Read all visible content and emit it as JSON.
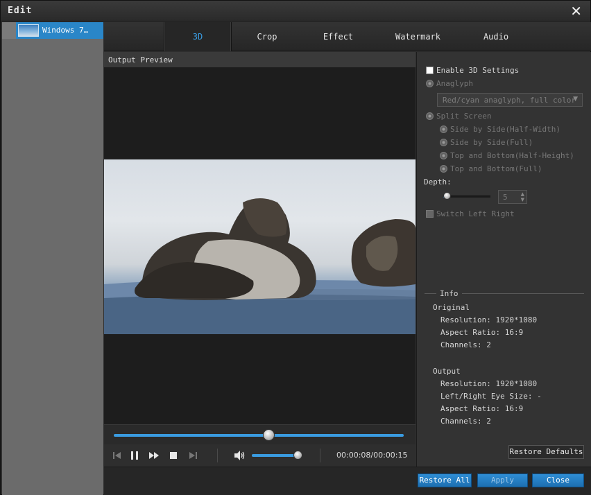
{
  "window": {
    "title": "Edit"
  },
  "file_list": {
    "items": [
      {
        "name": "Windows 7…",
        "selected": true
      }
    ]
  },
  "tabs": [
    {
      "label": "3D",
      "active": true
    },
    {
      "label": "Crop",
      "active": false
    },
    {
      "label": "Effect",
      "active": false
    },
    {
      "label": "Watermark",
      "active": false
    },
    {
      "label": "Audio",
      "active": false
    }
  ],
  "preview": {
    "label": "Output Preview"
  },
  "player": {
    "progress_fraction": 0.53,
    "volume_fraction": 0.92,
    "time": "00:00:08/00:00:15"
  },
  "settings_3d": {
    "enable_label": "Enable 3D Settings",
    "enabled": false,
    "anaglyph_label": "Anaglyph",
    "anaglyph_select_value": "Red/cyan anaglyph, full color",
    "split_screen_label": "Split Screen",
    "split_options": [
      "Side by Side(Half-Width)",
      "Side by Side(Full)",
      "Top and Bottom(Half-Height)",
      "Top and Bottom(Full)"
    ],
    "depth_label": "Depth:",
    "depth_value": "5",
    "switch_label": "Switch Left Right"
  },
  "info": {
    "title": "Info",
    "original_label": "Original",
    "original_resolution": "Resolution: 1920*1080",
    "original_aspect": "Aspect Ratio: 16:9",
    "original_channels": "Channels: 2",
    "output_label": "Output",
    "output_resolution": "Resolution: 1920*1080",
    "output_eye_size": "Left/Right Eye Size: -",
    "output_aspect": "Aspect Ratio: 16:9",
    "output_channels": "Channels: 2"
  },
  "buttons": {
    "restore_defaults": "Restore Defaults",
    "restore_all": "Restore All",
    "apply": "Apply",
    "close": "Close"
  },
  "colors": {
    "accent": "#3a9be0",
    "selected_item": "#2a86c8",
    "active_tab_text": "#3aa0e8"
  }
}
